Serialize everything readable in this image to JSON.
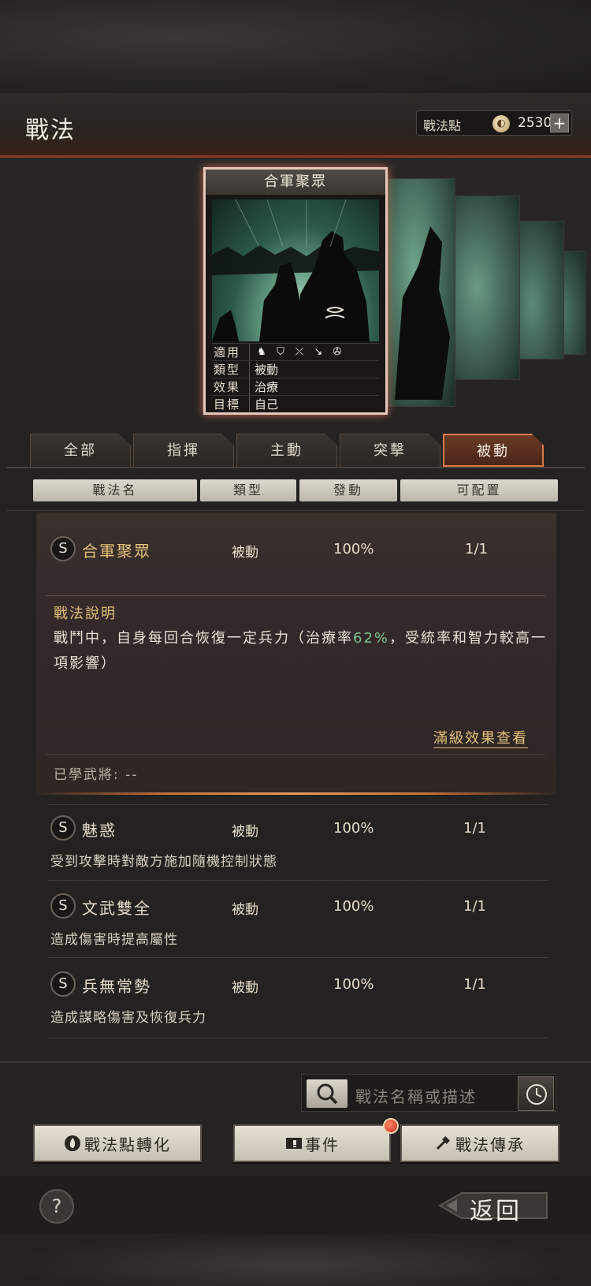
{
  "header": {
    "title": "戰法",
    "points_label": "戰法點",
    "points_value": "2530",
    "plus_label": "+"
  },
  "card": {
    "title": "合軍聚眾",
    "rows": [
      {
        "label": "適用",
        "value": ""
      },
      {
        "label": "類型",
        "value": "被動"
      },
      {
        "label": "效果",
        "value": "治療"
      },
      {
        "label": "目標",
        "value": "自己"
      }
    ],
    "unit_icons": [
      "cavalry-icon",
      "shield-icon",
      "archer-icon",
      "spear-icon",
      "siege-wheel-icon"
    ]
  },
  "tabs": [
    {
      "label": "全部"
    },
    {
      "label": "指揮"
    },
    {
      "label": "主動"
    },
    {
      "label": "突擊"
    },
    {
      "label": "被動",
      "active": true
    }
  ],
  "columns": [
    "戰法名",
    "類型",
    "發動",
    "可配置"
  ],
  "expanded": {
    "grade": "S",
    "name": "合軍聚眾",
    "type": "被動",
    "rate": "100%",
    "available": "1/1",
    "desc_title": "戰法說明",
    "desc_before": "戰鬥中，自身每回合恢復一定兵力（治療率",
    "desc_pct": "62%",
    "desc_after": "，受統率和智力較高一項影響）",
    "full_effect_link": "滿級效果查看",
    "learned": "已學武將: --"
  },
  "list": [
    {
      "grade": "S",
      "name": "魅惑",
      "type": "被動",
      "rate": "100%",
      "available": "1/1",
      "desc": "受到攻擊時對敵方施加隨機控制狀態"
    },
    {
      "grade": "S",
      "name": "文武雙全",
      "type": "被動",
      "rate": "100%",
      "available": "1/1",
      "desc": "造成傷害時提高屬性"
    },
    {
      "grade": "S",
      "name": "兵無常勢",
      "type": "被動",
      "rate": "100%",
      "available": "1/1",
      "desc": "造成謀略傷害及恢復兵力"
    }
  ],
  "search": {
    "placeholder": "戰法名稱或描述"
  },
  "buttons": {
    "convert": "戰法點轉化",
    "events": "事件",
    "inherit": "戰法傳承"
  },
  "footer": {
    "help": "?",
    "back": "返回"
  }
}
